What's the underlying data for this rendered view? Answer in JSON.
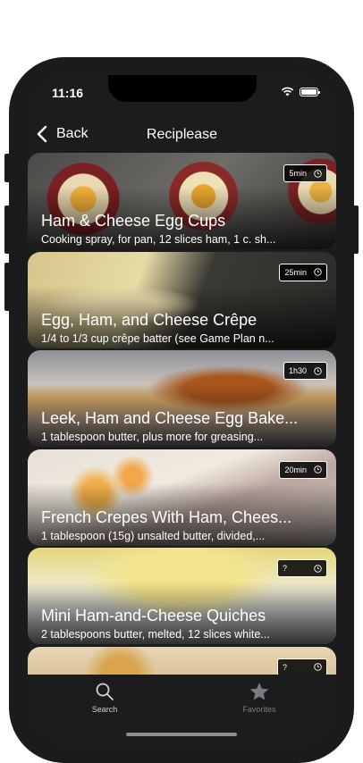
{
  "status_bar": {
    "time": "11:16"
  },
  "navbar": {
    "back_label": "Back",
    "title": "Reciplease"
  },
  "recipes": [
    {
      "title": "Ham & Cheese Egg Cups",
      "ingredients": "Cooking spray, for pan, 12 slices ham, 1 c. sh...",
      "time": "5min",
      "icon": "clock-icon"
    },
    {
      "title": "Egg, Ham, and Cheese Crêpe",
      "ingredients": "1/4 to 1/3 cup crêpe batter (see Game Plan n...",
      "time": "25min",
      "icon": "clock-icon"
    },
    {
      "title": "Leek, Ham and Cheese Egg Bake...",
      "ingredients": "1 tablespoon butter, plus more for greasing...",
      "time": "1h30",
      "icon": "clock-icon"
    },
    {
      "title": "French Crepes With Ham, Chees...",
      "ingredients": "1 tablespoon (15g) unsalted butter, divided,...",
      "time": "20min",
      "icon": "clock-icon"
    },
    {
      "title": "Mini Ham-and-Cheese Quiches",
      "ingredients": "2 tablespoons butter, melted, 12 slices white...",
      "time": "?",
      "icon": "clock-icon"
    },
    {
      "title": "",
      "ingredients": "",
      "time": "?",
      "icon": "clock-icon"
    }
  ],
  "tabbar": {
    "search_label": "Search",
    "favorites_label": "Favorites",
    "active_color": "#cfcfd4",
    "inactive_color": "#7c7c80"
  }
}
